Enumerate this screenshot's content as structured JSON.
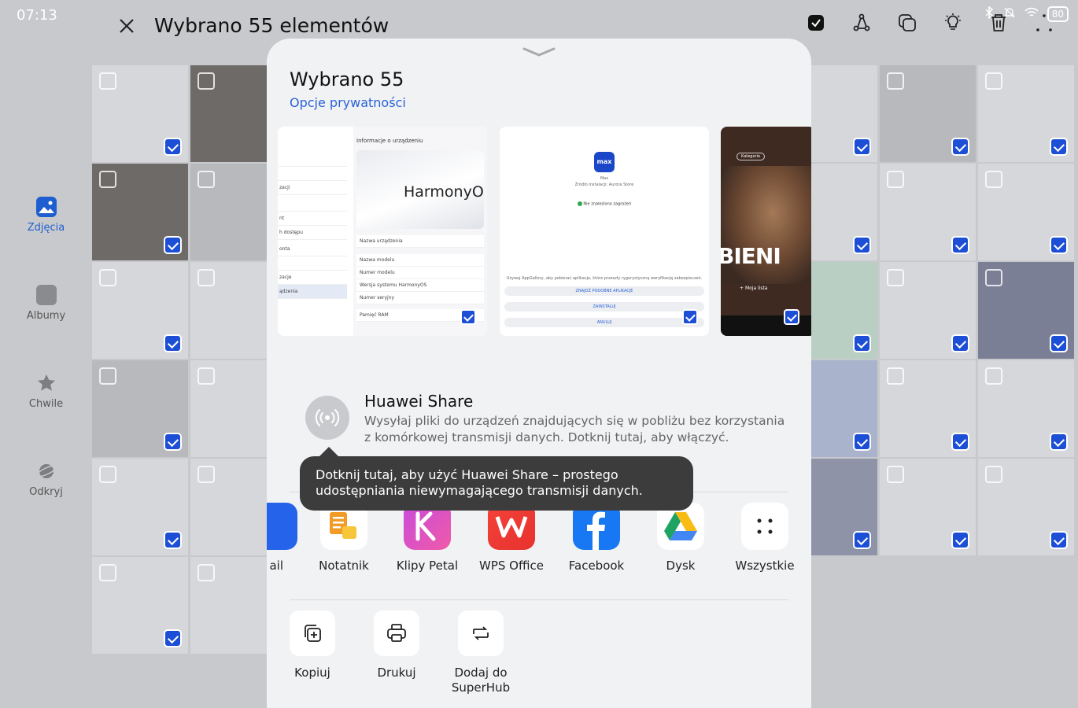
{
  "status": {
    "time": "07:13",
    "battery": "80"
  },
  "topbar": {
    "title": "Wybrano 55 elementów"
  },
  "nav": [
    {
      "label": "Zdjęcia",
      "active": true
    },
    {
      "label": "Albumy"
    },
    {
      "label": "Chwile"
    },
    {
      "label": "Odkryj"
    }
  ],
  "sheet": {
    "title": "Wybrano 55",
    "privacy_link": "Opcje prywatności",
    "previews": {
      "p1": {
        "header": "Informacje o urządzeniu",
        "harmony": "HarmonyOS",
        "left_rows": [
          "",
          "",
          "zacji",
          "",
          "nt",
          "h dostępu",
          "onta",
          "",
          "zacje",
          "ądzenia"
        ],
        "fields": [
          "Nazwa urządzenia",
          "Nazwa modelu",
          "Numer modelu",
          "Wersja systemu HarmonyOS",
          "Numer seryjny",
          "Pamięć RAM"
        ]
      },
      "p2": {
        "logo": "max",
        "app_name": "Max",
        "source": "Źródło instalacji: Aurora Store",
        "safe": "Nie znaleziono zagrożeń",
        "note": "Używaj AppGallery, aby pobierać aplikacje, które przeszły rygorystyczną weryfikację zabezpieczeń.",
        "btn1": "ZNAJDŹ PODOBNE APLIKACJE",
        "btn2": "ZAINSTALUJ",
        "btn3": "ANULUJ"
      },
      "p3": {
        "title": "BIENI",
        "chip": "Kategorie",
        "list": "Moja lista"
      }
    },
    "huawei_share": {
      "title": "Huawei Share",
      "desc": "Wysyłaj pliki do urządzeń znajdujących się w pobliżu bez korzystania z komórkowej transmisji danych. Dotknij tutaj, aby włączyć."
    },
    "tooltip": "Dotknij tutaj, aby użyć Huawei Share – prostego udostępniania niewymagającego transmisji danych.",
    "apps": [
      {
        "label": "ail",
        "icon": "mail-icon"
      },
      {
        "label": "Notatnik",
        "icon": "notepad-icon"
      },
      {
        "label": "Klipy Petal",
        "icon": "petal-clips-icon"
      },
      {
        "label": "WPS Office",
        "icon": "wps-office-icon"
      },
      {
        "label": "Facebook",
        "icon": "facebook-icon"
      },
      {
        "label": "Dysk",
        "icon": "google-drive-icon"
      },
      {
        "label": "Wszystkie",
        "icon": "more-apps-icon"
      }
    ],
    "actions": [
      {
        "label": "Kopiuj",
        "icon": "copy-icon"
      },
      {
        "label": "Drukuj",
        "icon": "print-icon"
      },
      {
        "label": "Dodaj do SuperHub",
        "icon": "superhub-icon"
      }
    ]
  },
  "colors": {
    "accent": "#1f5ed1",
    "check": "#1d4fd6",
    "tooltip": "#3c3c3d",
    "sheet": "#f1f2f4"
  }
}
